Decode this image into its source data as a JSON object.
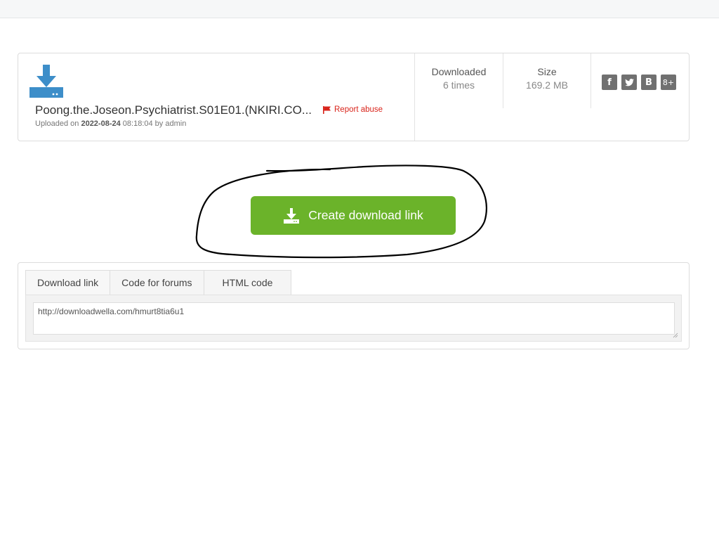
{
  "file": {
    "name": "Poong.the.Joseon.Psychiatrist.S01E01.(NKIRI.CO...",
    "report_label": "Report abuse",
    "uploaded_prefix": "Uploaded on",
    "uploaded_date": "2022-08-24",
    "uploaded_time": "08:18:04 by admin",
    "icon": "download-icon"
  },
  "stats": {
    "downloaded_label": "Downloaded",
    "downloaded_value": "6 times",
    "size_label": "Size",
    "size_value": "169.2 MB"
  },
  "social": [
    "f",
    "t",
    "B",
    "8+"
  ],
  "button": {
    "label": "Create download link",
    "icon": "download-icon",
    "color": "#6bb32a"
  },
  "tabs": [
    {
      "label": "Download link",
      "active": true
    },
    {
      "label": "Code for forums",
      "active": false
    },
    {
      "label": "HTML code",
      "active": false
    }
  ],
  "code_field": {
    "value": "http://downloadwella.com/hmurt8tia6u1"
  },
  "colors": {
    "accent": "#6bb32a",
    "report": "#d9241b",
    "icon_blue": "#3d8ec9"
  }
}
